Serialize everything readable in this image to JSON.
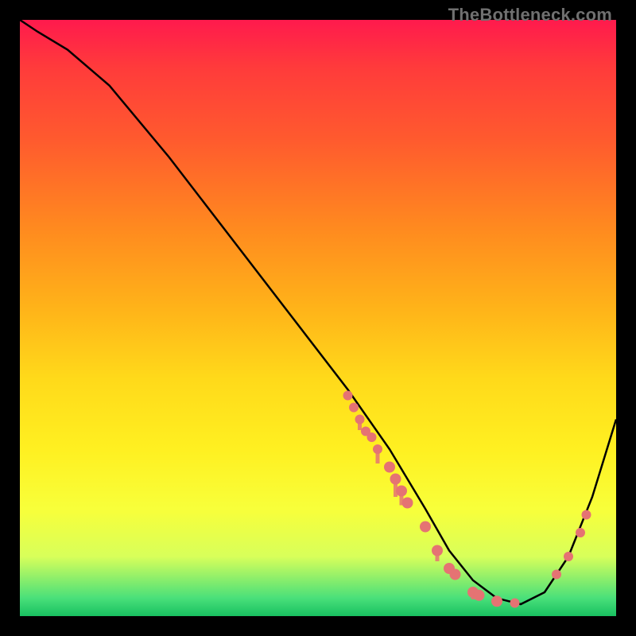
{
  "watermark": "TheBottleneck.com",
  "chart_data": {
    "type": "line",
    "title": "",
    "xlabel": "",
    "ylabel": "",
    "xlim": [
      0,
      100
    ],
    "ylim": [
      0,
      100
    ],
    "grid": false,
    "series": [
      {
        "name": "curve",
        "x": [
          0,
          3,
          8,
          15,
          25,
          35,
          45,
          55,
          62,
          68,
          72,
          76,
          80,
          84,
          88,
          92,
          96,
          100
        ],
        "y": [
          100,
          98,
          95,
          89,
          77,
          64,
          51,
          38,
          28,
          18,
          11,
          6,
          3,
          2,
          4,
          10,
          20,
          33
        ]
      }
    ],
    "points": [
      {
        "x": 55,
        "y": 37,
        "r": 6
      },
      {
        "x": 56,
        "y": 35,
        "r": 6
      },
      {
        "x": 57,
        "y": 33,
        "r": 6
      },
      {
        "x": 58,
        "y": 31,
        "r": 6
      },
      {
        "x": 59,
        "y": 30,
        "r": 6
      },
      {
        "x": 60,
        "y": 28,
        "r": 6
      },
      {
        "x": 62,
        "y": 25,
        "r": 7
      },
      {
        "x": 63,
        "y": 23,
        "r": 7
      },
      {
        "x": 64,
        "y": 21,
        "r": 7
      },
      {
        "x": 65,
        "y": 19,
        "r": 7
      },
      {
        "x": 68,
        "y": 15,
        "r": 7
      },
      {
        "x": 70,
        "y": 11,
        "r": 7
      },
      {
        "x": 72,
        "y": 8,
        "r": 7
      },
      {
        "x": 73,
        "y": 7,
        "r": 7
      },
      {
        "x": 76,
        "y": 4,
        "r": 7
      },
      {
        "x": 77,
        "y": 3.5,
        "r": 7
      },
      {
        "x": 80,
        "y": 2.5,
        "r": 7
      },
      {
        "x": 83,
        "y": 2.2,
        "r": 6
      },
      {
        "x": 90,
        "y": 7,
        "r": 6
      },
      {
        "x": 92,
        "y": 10,
        "r": 6
      },
      {
        "x": 94,
        "y": 14,
        "r": 6
      },
      {
        "x": 95,
        "y": 17,
        "r": 6
      }
    ],
    "drips": [
      {
        "x": 57,
        "y": 33,
        "len": 3
      },
      {
        "x": 60,
        "y": 28,
        "len": 4
      },
      {
        "x": 63,
        "y": 23,
        "len": 5
      },
      {
        "x": 64,
        "y": 21,
        "len": 4
      },
      {
        "x": 70,
        "y": 11,
        "len": 3
      },
      {
        "x": 76,
        "y": 4,
        "len": 2
      }
    ],
    "colors": {
      "curve": "#000000",
      "points": "#e57373"
    }
  }
}
